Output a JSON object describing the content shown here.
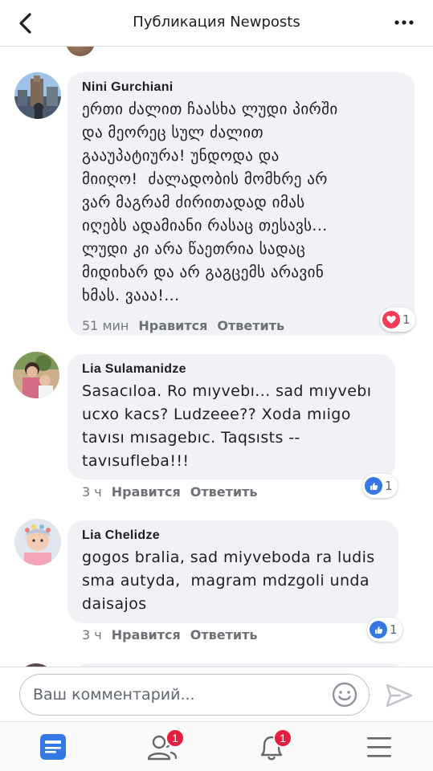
{
  "header": {
    "title": "Публикация Newposts",
    "back_icon": "chevron-left-icon",
    "more_icon": "more-horizontal-icon"
  },
  "comments": [
    {
      "name": "Nini Gurchiani",
      "text": "ერთი ძალით ჩაასხა ლუდი პირში\nდა მეორეც სულ ძალით\nგააუპატიურა! უნდოდა და\nმიიღო!  ძალადობის მომხრე არ\nვარ მაგრამ ძირითადად იმას\nიღებს ადამიანი რასაც თესავს...\nლუდი კი არა წაეთრია სადაც\nმიდიხარ და არ გაგცემს არავინ\nხმას. ვააა!...",
      "time": "51 мин",
      "like_label": "Нравится",
      "reply_label": "Ответить",
      "reaction": "love",
      "reaction_count": "1"
    },
    {
      "name": "Lia Sulamanidze",
      "text": "Sasacıloa. Ro mıyvebı... sad mıyvebı\nucxo kacs? Ludzeee?? Xoda mıigo\ntavısı mısagebıc. Taqsısts --\ntavısufleba!!!",
      "time": "3 ч",
      "like_label": "Нравится",
      "reply_label": "Ответить",
      "reaction": "like",
      "reaction_count": "1"
    },
    {
      "name": "Lia Chelidze",
      "text": "gogos bralia, sad miyveboda ra ludis\nsma autyda,  magram mdzgoli unda\ndaisajos",
      "time": "3 ч",
      "like_label": "Нравится",
      "reply_label": "Ответить",
      "reaction": "like",
      "reaction_count": "1"
    }
  ],
  "composer": {
    "placeholder": "Ваш комментарий...",
    "emoji_icon": "smiley-icon",
    "send_icon": "send-icon"
  },
  "tabbar": {
    "tabs": [
      {
        "icon": "news-feed-icon",
        "badge": ""
      },
      {
        "icon": "friend-requests-icon",
        "badge": "1"
      },
      {
        "icon": "notifications-bell-icon",
        "badge": "1"
      },
      {
        "icon": "menu-icon",
        "badge": ""
      }
    ]
  },
  "colors": {
    "accent": "#3578e5",
    "love": "#f33e58",
    "badge": "#e41e3f",
    "bubble": "#f0f2f5"
  }
}
